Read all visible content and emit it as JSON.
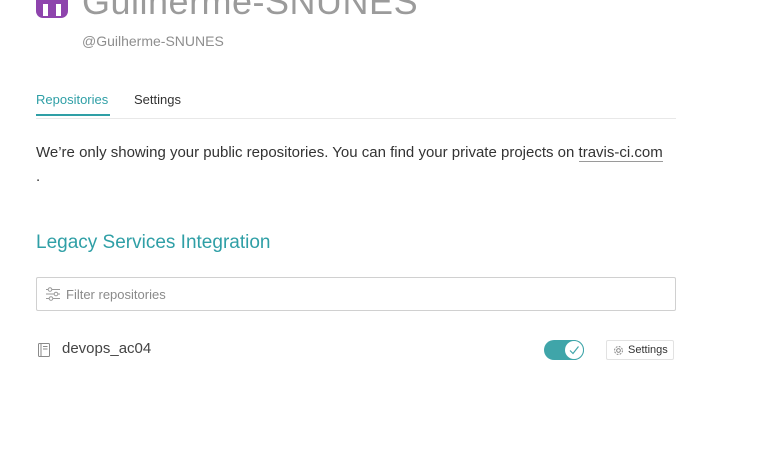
{
  "owner": {
    "name": "Guilherme-SNUNES",
    "handle": "@Guilherme-SNUNES"
  },
  "tabs": [
    {
      "label": "Repositories",
      "active": true
    },
    {
      "label": "Settings",
      "active": false
    }
  ],
  "notice": {
    "text": "We’re only showing your public repositories. You can find your private projects on ",
    "link_text": "travis-ci.com",
    "trailing": "."
  },
  "section": {
    "title": "Legacy Services Integration"
  },
  "filter": {
    "placeholder": "Filter repositories",
    "value": ""
  },
  "repositories": [
    {
      "name": "devops_ac04",
      "enabled": true,
      "settings_label": "Settings"
    }
  ],
  "colors": {
    "accent": "#2f9fa6",
    "toggle_on": "#3fa5a9",
    "avatar": "#8e44ad"
  },
  "icons": {
    "avatar": "owner-avatar-icon",
    "filter": "sliders-filter-icon",
    "repo": "book-repo-icon",
    "toggle_check": "check-icon",
    "settings": "gear-icon"
  }
}
